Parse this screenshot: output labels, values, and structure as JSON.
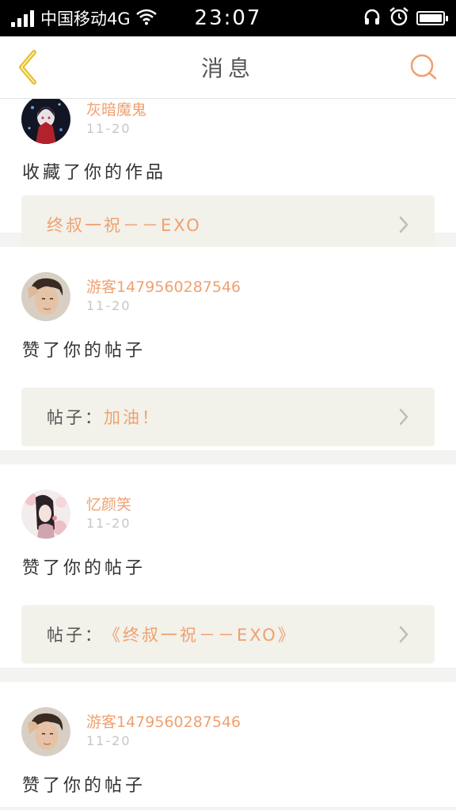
{
  "status_bar": {
    "carrier": "中国移动4G",
    "time": "23:07",
    "battery_level": 1.0
  },
  "header": {
    "title": "消息"
  },
  "colors": {
    "accent": "#f0a070",
    "back_icon": "#e6c030",
    "ref_box_bg": "#f2f1ea"
  },
  "notifications": [
    {
      "username": "灰暗魔鬼",
      "time": "11-20",
      "action": "收藏了你的作品",
      "ref_prefix": "",
      "ref_title": "终叔一祝－－EXO",
      "avatar_icon": "avatar-dark-anime"
    },
    {
      "username": "游客1479560287546",
      "time": "11-20",
      "action": "赞了你的帖子",
      "ref_prefix": "帖子：",
      "ref_title": "加油！",
      "avatar_icon": "avatar-boy-photo"
    },
    {
      "username": "忆颜笑",
      "time": "11-20",
      "action": "赞了你的帖子",
      "ref_prefix": "帖子：",
      "ref_title": "《终叔一祝－－EXO》",
      "avatar_icon": "avatar-floral-girl"
    },
    {
      "username": "游客1479560287546",
      "time": "11-20",
      "action": "赞了你的帖子",
      "avatar_icon": "avatar-boy-photo"
    }
  ]
}
